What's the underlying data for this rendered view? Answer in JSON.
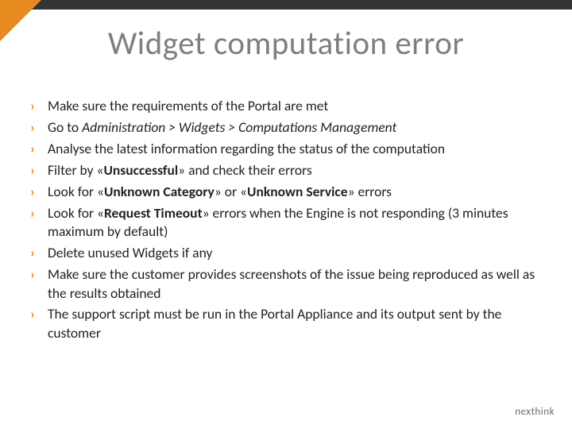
{
  "title": "Widget computation error",
  "bullets": [
    {
      "html": "Make sure the requirements of the Portal are met"
    },
    {
      "html": "Go to <em class=\"nav\">Administration &gt; Widgets &gt; Computations Management</em>"
    },
    {
      "html": "Analyse the latest information regarding the status of the computation"
    },
    {
      "html": "Filter by «<strong>Unsuccessful</strong>» and check their errors"
    },
    {
      "html": "Look for «<strong>Unknown Category</strong>» or «<strong>Unknown Service</strong>» errors"
    },
    {
      "html": "Look for «<strong>Request Timeout</strong>» errors when the Engine is not responding (3 minutes maximum by default)"
    },
    {
      "html": "Delete unused Widgets if any"
    },
    {
      "html": "Make sure the customer provides screenshots of the issue being reproduced as well as the results obtained"
    },
    {
      "html": "The support script must be run in the Portal Appliance and its output sent by the customer"
    }
  ],
  "bullet_marker": "›",
  "logo": "nexthink",
  "colors": {
    "accent": "#e78b1f",
    "topbar": "#343434",
    "title": "#7f7f7f",
    "text": "#222"
  }
}
